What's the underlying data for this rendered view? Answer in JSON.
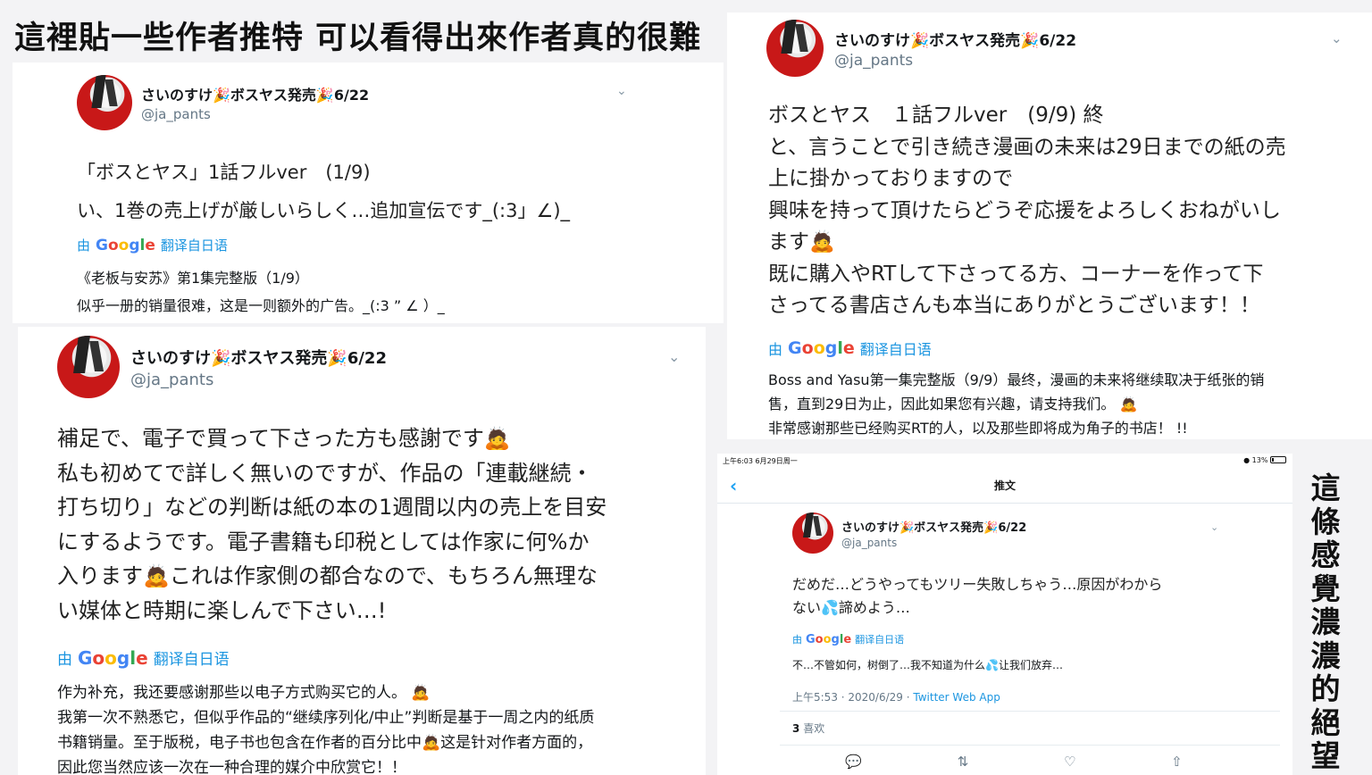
{
  "headline": "這裡貼一些作者推特 可以看得出來作者真的很難",
  "vertical_caption": [
    "這",
    "條",
    "感",
    "覺",
    "濃",
    "濃",
    "的",
    "絕",
    "望"
  ],
  "tweets": [
    {
      "name": "さいのすけ🎉ボスヤス発売🎉6/22",
      "handle": "@ja_pants",
      "text": [
        "「ボスとヤス」1話フルver　(1/9)",
        "い、1巻の売上げが厳しいらしく…追加宣伝です_(:3」∠)_"
      ],
      "translate_prefix": "由",
      "translate_label": "翻译自日语",
      "translation": [
        "《老板与安苏》第1集完整版（1/9）",
        "似乎一册的销量很难，这是一则额外的广告。_(:3 ” ∠ ）_"
      ]
    },
    {
      "name": "さいのすけ🎉ボスヤス発売🎉6/22",
      "handle": "@ja_pants",
      "text": [
        "補足で、電子で買って下さった方も感謝です🙇",
        "私も初めてで詳しく無いのですが、作品の「連載継続・",
        "打ち切り」などの判断は紙の本の1週間以内の売上を目安",
        "にするようです。電子書籍も印税としては作家に何%か",
        "入ります🙇これは作家側の都合なので、もちろん無理な",
        "い媒体と時期に楽しんで下さい…!"
      ],
      "translate_prefix": "由",
      "translate_label": "翻译自日语",
      "translation": [
        "作为补充，我还要感谢那些以电子方式购买它的人。 🙇",
        "我第一次不熟悉它，但似乎作品的“继续序列化/中止”判断是基于一周之内的纸质",
        "书籍销量。至于版税，电子书也包含在作者的百分比中🙇这是针对作者方面的，",
        "因此您当然应该一次在一种合理的媒介中欣赏它！！"
      ]
    },
    {
      "name": "さいのすけ🎉ボスヤス発売🎉6/22",
      "handle": "@ja_pants",
      "text": [
        "ボスとヤス　１話フルver　(9/9) 終",
        "と、言うことで引き続き漫画の未来は29日までの紙の売",
        "上に掛かっておりますので",
        "興味を持って頂けたらどうぞ応援をよろしくおねがいし",
        "ます🙇",
        "既に購入やRTして下さってる方、コーナーを作って下",
        "さってる書店さんも本当にありがとうございます！！"
      ],
      "translate_prefix": "由",
      "translate_label": "翻译自日语",
      "translation": [
        "Boss and Yasu第一集完整版（9/9）最终，漫画的未来将继续取决于纸张的销",
        "售，直到29日为止，因此如果您有兴趣，请支持我们。 🙇",
        "非常感谢那些已经购买RT的人，以及那些即将成为角子的书店！ !!"
      ]
    },
    {
      "statusbar_left": "上午6:03  6月29日周一",
      "statusbar_right": "13%",
      "nav_title": "推文",
      "name": "さいのすけ🎉ボスヤス発売🎉6/22",
      "handle": "@ja_pants",
      "text": [
        "だめだ…どうやってもツリー失敗しちゃう…原因がわから",
        "ない💦諦めよう…"
      ],
      "translate_prefix": "由",
      "translate_label": "翻译自日语",
      "translation": [
        "不…不管如何，树倒了…我不知道为什么💦让我们放弃…"
      ],
      "time": "上午5:53 · 2020/6/29 · ",
      "source": "Twitter Web App",
      "likes_count": "3",
      "likes_label": "喜欢"
    }
  ],
  "google_word": [
    "G",
    "o",
    "o",
    "g",
    "l",
    "e"
  ],
  "icons": {
    "chevron": "chevron-down-icon",
    "back": "back-arrow-icon",
    "reply": "reply-icon",
    "retweet": "retweet-icon",
    "like": "heart-icon",
    "share": "share-icon"
  }
}
